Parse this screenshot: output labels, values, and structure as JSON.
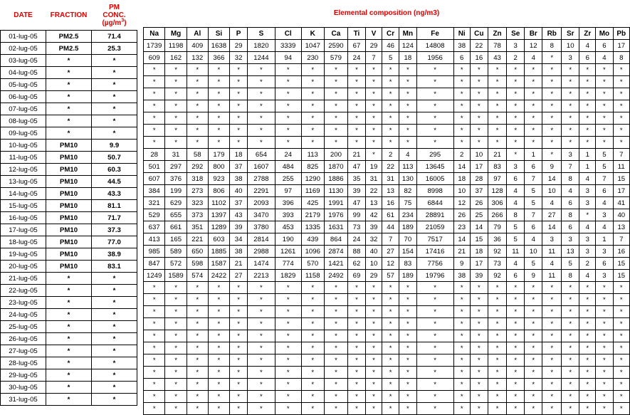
{
  "headers": {
    "date": "DATE",
    "fraction": "FRACTION",
    "conc_line1": "PM",
    "conc_line2": "CONC.",
    "conc_unit_main": "(µg/m",
    "conc_unit_sup": "3",
    "conc_unit_close": ")",
    "composition_title": "Elemental composition (ng/m3)"
  },
  "elements": [
    "Na",
    "Mg",
    "Al",
    "Si",
    "P",
    "S",
    "Cl",
    "K",
    "Ca",
    "Ti",
    "V",
    "Cr",
    "Mn",
    "Fe",
    "Ni",
    "Cu",
    "Zn",
    "Se",
    "Br",
    "Rb",
    "Sr",
    "Zr",
    "Mo",
    "Pb"
  ],
  "rows": [
    {
      "date": "01-lug-05",
      "fraction": "PM2.5",
      "conc": "71.4",
      "values": [
        "1739",
        "1198",
        "409",
        "1638",
        "29",
        "1820",
        "3339",
        "1047",
        "2590",
        "67",
        "29",
        "46",
        "124",
        "14808",
        "38",
        "22",
        "78",
        "3",
        "12",
        "8",
        "10",
        "4",
        "6",
        "17"
      ]
    },
    {
      "date": "02-lug-05",
      "fraction": "PM2.5",
      "conc": "25.3",
      "values": [
        "609",
        "162",
        "132",
        "366",
        "32",
        "1244",
        "94",
        "230",
        "579",
        "24",
        "7",
        "5",
        "18",
        "1956",
        "6",
        "16",
        "43",
        "2",
        "4",
        "*",
        "3",
        "6",
        "4",
        "8"
      ]
    },
    {
      "date": "03-lug-05",
      "fraction": "*",
      "conc": "*",
      "values": [
        "*",
        "*",
        "*",
        "*",
        "*",
        "*",
        "*",
        "*",
        "*",
        "*",
        "*",
        "*",
        "*",
        "*",
        "*",
        "*",
        "*",
        "*",
        "*",
        "*",
        "*",
        "*",
        "*",
        "*"
      ]
    },
    {
      "date": "04-lug-05",
      "fraction": "*",
      "conc": "*",
      "values": [
        "*",
        "*",
        "*",
        "*",
        "*",
        "*",
        "*",
        "*",
        "*",
        "*",
        "*",
        "*",
        "*",
        "*",
        "*",
        "*",
        "*",
        "*",
        "*",
        "*",
        "*",
        "*",
        "*",
        "*"
      ]
    },
    {
      "date": "05-lug-05",
      "fraction": "*",
      "conc": "*",
      "values": [
        "*",
        "*",
        "*",
        "*",
        "*",
        "*",
        "*",
        "*",
        "*",
        "*",
        "*",
        "*",
        "*",
        "*",
        "*",
        "*",
        "*",
        "*",
        "*",
        "*",
        "*",
        "*",
        "*",
        "*"
      ]
    },
    {
      "date": "06-lug-05",
      "fraction": "*",
      "conc": "*",
      "values": [
        "*",
        "*",
        "*",
        "*",
        "*",
        "*",
        "*",
        "*",
        "*",
        "*",
        "*",
        "*",
        "*",
        "*",
        "*",
        "*",
        "*",
        "*",
        "*",
        "*",
        "*",
        "*",
        "*",
        "*"
      ]
    },
    {
      "date": "07-lug-05",
      "fraction": "*",
      "conc": "*",
      "values": [
        "*",
        "*",
        "*",
        "*",
        "*",
        "*",
        "*",
        "*",
        "*",
        "*",
        "*",
        "*",
        "*",
        "*",
        "*",
        "*",
        "*",
        "*",
        "*",
        "*",
        "*",
        "*",
        "*",
        "*"
      ]
    },
    {
      "date": "08-lug-05",
      "fraction": "*",
      "conc": "*",
      "values": [
        "*",
        "*",
        "*",
        "*",
        "*",
        "*",
        "*",
        "*",
        "*",
        "*",
        "*",
        "*",
        "*",
        "*",
        "*",
        "*",
        "*",
        "*",
        "*",
        "*",
        "*",
        "*",
        "*",
        "*"
      ]
    },
    {
      "date": "09-lug-05",
      "fraction": "*",
      "conc": "*",
      "values": [
        "*",
        "*",
        "*",
        "*",
        "*",
        "*",
        "*",
        "*",
        "*",
        "*",
        "*",
        "*",
        "*",
        "*",
        "*",
        "*",
        "*",
        "*",
        "*",
        "*",
        "*",
        "*",
        "*",
        "*"
      ]
    },
    {
      "date": "10-lug-05",
      "fraction": "PM10",
      "conc": "9.9",
      "values": [
        "28",
        "31",
        "58",
        "179",
        "18",
        "654",
        "24",
        "113",
        "200",
        "21",
        "*",
        "2",
        "4",
        "295",
        "2",
        "10",
        "21",
        "*",
        "1",
        "*",
        "3",
        "1",
        "5",
        "7"
      ]
    },
    {
      "date": "11-lug-05",
      "fraction": "PM10",
      "conc": "50.7",
      "values": [
        "501",
        "297",
        "292",
        "800",
        "37",
        "1607",
        "484",
        "825",
        "1870",
        "47",
        "19",
        "22",
        "113",
        "13645",
        "14",
        "17",
        "83",
        "3",
        "6",
        "9",
        "7",
        "1",
        "5",
        "11"
      ]
    },
    {
      "date": "12-lug-05",
      "fraction": "PM10",
      "conc": "60.3",
      "values": [
        "607",
        "376",
        "318",
        "923",
        "38",
        "2788",
        "255",
        "1290",
        "1886",
        "35",
        "31",
        "31",
        "130",
        "16005",
        "18",
        "28",
        "97",
        "6",
        "7",
        "14",
        "8",
        "4",
        "7",
        "15"
      ]
    },
    {
      "date": "13-lug-05",
      "fraction": "PM10",
      "conc": "44.5",
      "values": [
        "384",
        "199",
        "273",
        "806",
        "40",
        "2291",
        "97",
        "1169",
        "1130",
        "39",
        "22",
        "13",
        "82",
        "8998",
        "10",
        "37",
        "128",
        "4",
        "5",
        "10",
        "4",
        "3",
        "6",
        "17"
      ]
    },
    {
      "date": "14-lug-05",
      "fraction": "PM10",
      "conc": "43.3",
      "values": [
        "321",
        "629",
        "323",
        "1102",
        "37",
        "2093",
        "396",
        "425",
        "1991",
        "47",
        "13",
        "16",
        "75",
        "6844",
        "12",
        "26",
        "306",
        "4",
        "5",
        "4",
        "6",
        "3",
        "4",
        "41"
      ]
    },
    {
      "date": "15-lug-05",
      "fraction": "PM10",
      "conc": "81.1",
      "values": [
        "529",
        "655",
        "373",
        "1397",
        "43",
        "3470",
        "393",
        "2179",
        "1976",
        "99",
        "42",
        "61",
        "234",
        "28891",
        "26",
        "25",
        "266",
        "8",
        "7",
        "27",
        "8",
        "*",
        "3",
        "40"
      ]
    },
    {
      "date": "16-lug-05",
      "fraction": "PM10",
      "conc": "71.7",
      "values": [
        "637",
        "661",
        "351",
        "1289",
        "39",
        "3780",
        "453",
        "1335",
        "1631",
        "73",
        "39",
        "44",
        "189",
        "21059",
        "23",
        "14",
        "79",
        "5",
        "6",
        "14",
        "6",
        "4",
        "4",
        "13"
      ]
    },
    {
      "date": "17-lug-05",
      "fraction": "PM10",
      "conc": "37.3",
      "values": [
        "413",
        "165",
        "221",
        "603",
        "34",
        "2814",
        "190",
        "439",
        "864",
        "24",
        "32",
        "7",
        "70",
        "7517",
        "14",
        "15",
        "36",
        "5",
        "4",
        "3",
        "3",
        "3",
        "1",
        "7"
      ]
    },
    {
      "date": "18-lug-05",
      "fraction": "PM10",
      "conc": "77.0",
      "values": [
        "985",
        "589",
        "650",
        "1885",
        "38",
        "2988",
        "1261",
        "1096",
        "2874",
        "88",
        "40",
        "27",
        "154",
        "17416",
        "21",
        "18",
        "92",
        "11",
        "10",
        "11",
        "13",
        "3",
        "3",
        "16"
      ]
    },
    {
      "date": "19-lug-05",
      "fraction": "PM10",
      "conc": "38.9",
      "values": [
        "847",
        "572",
        "598",
        "1587",
        "21",
        "1474",
        "774",
        "570",
        "1421",
        "62",
        "10",
        "12",
        "83",
        "7756",
        "9",
        "17",
        "73",
        "4",
        "5",
        "4",
        "5",
        "2",
        "6",
        "15"
      ]
    },
    {
      "date": "20-lug-05",
      "fraction": "PM10",
      "conc": "83.1",
      "values": [
        "1249",
        "1589",
        "574",
        "2422",
        "27",
        "2213",
        "1829",
        "1158",
        "2492",
        "69",
        "29",
        "57",
        "189",
        "19796",
        "38",
        "39",
        "92",
        "6",
        "9",
        "11",
        "8",
        "4",
        "3",
        "15"
      ]
    },
    {
      "date": "21-lug-05",
      "fraction": "*",
      "conc": "*",
      "values": [
        "*",
        "*",
        "*",
        "*",
        "*",
        "*",
        "*",
        "*",
        "*",
        "*",
        "*",
        "*",
        "*",
        "*",
        "*",
        "*",
        "*",
        "*",
        "*",
        "*",
        "*",
        "*",
        "*",
        "*"
      ]
    },
    {
      "date": "22-lug-05",
      "fraction": "*",
      "conc": "*",
      "values": [
        "*",
        "*",
        "*",
        "*",
        "*",
        "*",
        "*",
        "*",
        "*",
        "*",
        "*",
        "*",
        "*",
        "*",
        "*",
        "*",
        "*",
        "*",
        "*",
        "*",
        "*",
        "*",
        "*",
        "*"
      ]
    },
    {
      "date": "23-lug-05",
      "fraction": "*",
      "conc": "*",
      "values": [
        "*",
        "*",
        "*",
        "*",
        "*",
        "*",
        "*",
        "*",
        "*",
        "*",
        "*",
        "*",
        "*",
        "*",
        "*",
        "*",
        "*",
        "*",
        "*",
        "*",
        "*",
        "*",
        "*",
        "*"
      ]
    },
    {
      "date": "24-lug-05",
      "fraction": "*",
      "conc": "*",
      "values": [
        "*",
        "*",
        "*",
        "*",
        "*",
        "*",
        "*",
        "*",
        "*",
        "*",
        "*",
        "*",
        "*",
        "*",
        "*",
        "*",
        "*",
        "*",
        "*",
        "*",
        "*",
        "*",
        "*",
        "*"
      ]
    },
    {
      "date": "25-lug-05",
      "fraction": "*",
      "conc": "*",
      "values": [
        "*",
        "*",
        "*",
        "*",
        "*",
        "*",
        "*",
        "*",
        "*",
        "*",
        "*",
        "*",
        "*",
        "*",
        "*",
        "*",
        "*",
        "*",
        "*",
        "*",
        "*",
        "*",
        "*",
        "*"
      ]
    },
    {
      "date": "26-lug-05",
      "fraction": "*",
      "conc": "*",
      "values": [
        "*",
        "*",
        "*",
        "*",
        "*",
        "*",
        "*",
        "*",
        "*",
        "*",
        "*",
        "*",
        "*",
        "*",
        "*",
        "*",
        "*",
        "*",
        "*",
        "*",
        "*",
        "*",
        "*",
        "*"
      ]
    },
    {
      "date": "27-lug-05",
      "fraction": "*",
      "conc": "*",
      "values": [
        "*",
        "*",
        "*",
        "*",
        "*",
        "*",
        "*",
        "*",
        "*",
        "*",
        "*",
        "*",
        "*",
        "*",
        "*",
        "*",
        "*",
        "*",
        "*",
        "*",
        "*",
        "*",
        "*",
        "*"
      ]
    },
    {
      "date": "28-lug-05",
      "fraction": "*",
      "conc": "*",
      "values": [
        "*",
        "*",
        "*",
        "*",
        "*",
        "*",
        "*",
        "*",
        "*",
        "*",
        "*",
        "*",
        "*",
        "*",
        "*",
        "*",
        "*",
        "*",
        "*",
        "*",
        "*",
        "*",
        "*",
        "*"
      ]
    },
    {
      "date": "29-lug-05",
      "fraction": "*",
      "conc": "*",
      "values": [
        "*",
        "*",
        "*",
        "*",
        "*",
        "*",
        "*",
        "*",
        "*",
        "*",
        "*",
        "*",
        "*",
        "*",
        "*",
        "*",
        "*",
        "*",
        "*",
        "*",
        "*",
        "*",
        "*",
        "*"
      ]
    },
    {
      "date": "30-lug-05",
      "fraction": "*",
      "conc": "*",
      "values": [
        "*",
        "*",
        "*",
        "*",
        "*",
        "*",
        "*",
        "*",
        "*",
        "*",
        "*",
        "*",
        "*",
        "*",
        "*",
        "*",
        "*",
        "*",
        "*",
        "*",
        "*",
        "*",
        "*",
        "*"
      ]
    },
    {
      "date": "31-lug-05",
      "fraction": "*",
      "conc": "*",
      "values": [
        "*",
        "*",
        "*",
        "*",
        "*",
        "*",
        "*",
        "*",
        "*",
        "*",
        "*",
        "*",
        "*",
        "*",
        "*",
        "*",
        "*",
        "*",
        "*",
        "*",
        "*",
        "*",
        "*",
        "*"
      ]
    }
  ]
}
